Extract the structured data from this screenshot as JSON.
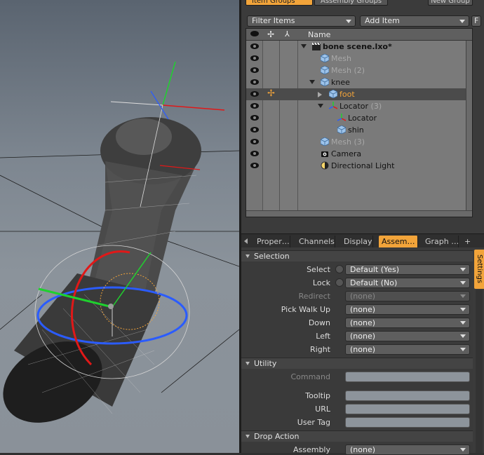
{
  "groups_bar": {
    "tabs": [
      "Item Groups",
      "Assembly Groups"
    ],
    "new_group": "New Group"
  },
  "toolbar": {
    "filter_label": "Filter Items",
    "add_item_label": "Add Item",
    "f_label": "F"
  },
  "tree": {
    "header_name": "Name",
    "rows": [
      {
        "label": "bone scene.lxo*",
        "count": "",
        "style": "bold",
        "icon": "clapper-icon",
        "expand": "down",
        "indent": 0
      },
      {
        "label": "Mesh",
        "count": "",
        "style": "dim",
        "icon": "mesh-cube-icon",
        "expand": "",
        "indent": 1
      },
      {
        "label": "Mesh",
        "count": "(2)",
        "style": "dim",
        "icon": "mesh-cube-icon",
        "expand": "",
        "indent": 1
      },
      {
        "label": "knee",
        "count": "",
        "style": "normal",
        "icon": "mesh-cube-icon",
        "expand": "down",
        "indent": 1
      },
      {
        "label": "foot",
        "count": "",
        "style": "orange",
        "icon": "mesh-cube-icon",
        "expand": "right",
        "indent": 2,
        "selected": true
      },
      {
        "label": "Locator",
        "count": "(3)",
        "style": "normal",
        "icon": "locator-icon",
        "expand": "down",
        "indent": 2
      },
      {
        "label": "Locator",
        "count": "",
        "style": "normal",
        "icon": "locator-icon",
        "expand": "",
        "indent": 3
      },
      {
        "label": "shin",
        "count": "",
        "style": "normal",
        "icon": "mesh-cube-icon",
        "expand": "",
        "indent": 3
      },
      {
        "label": "Mesh",
        "count": "(3)",
        "style": "dim",
        "icon": "mesh-cube-icon",
        "expand": "",
        "indent": 1
      },
      {
        "label": "Camera",
        "count": "",
        "style": "normal",
        "icon": "camera-icon",
        "expand": "",
        "indent": 1
      },
      {
        "label": "Directional Light",
        "count": "",
        "style": "normal",
        "icon": "light-icon",
        "expand": "",
        "indent": 1
      }
    ]
  },
  "tabs": [
    "Proper…",
    "Channels",
    "Display",
    "Assem…",
    "Graph …",
    "+"
  ],
  "active_tab": "Assem…",
  "settings_tab": "Settings",
  "sections": {
    "selection": "Selection",
    "utility": "Utility",
    "drop_action": "Drop Action"
  },
  "props": {
    "select": {
      "label": "Select",
      "value": "Default (Yes)"
    },
    "lock": {
      "label": "Lock",
      "value": "Default (No)"
    },
    "redirect": {
      "label": "Redirect",
      "value": "(none)"
    },
    "pick_walk_up": {
      "label": "Pick Walk Up",
      "value": "(none)"
    },
    "down": {
      "label": "Down",
      "value": "(none)"
    },
    "left": {
      "label": "Left",
      "value": "(none)"
    },
    "right": {
      "label": "Right",
      "value": "(none)"
    },
    "command": {
      "label": "Command",
      "value": ""
    },
    "tooltip": {
      "label": "Tooltip",
      "value": ""
    },
    "url": {
      "label": "URL",
      "value": ""
    },
    "user_tag": {
      "label": "User Tag",
      "value": ""
    },
    "assembly": {
      "label": "Assembly",
      "value": "(none)"
    }
  },
  "colors": {
    "accent": "#f2a43a",
    "axis_x": "#e01818",
    "axis_y": "#1fd12e",
    "axis_z": "#2b5cff"
  }
}
